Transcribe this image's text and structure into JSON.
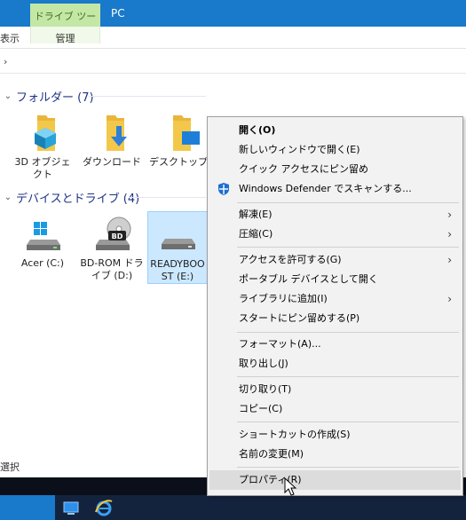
{
  "ribbon": {
    "context_tab": "ドライブ ツール",
    "window_title": "PC",
    "view_tab": "表示",
    "manage_tab": "管理"
  },
  "address": {
    "chevron": "›"
  },
  "folders_group": {
    "label": "フォルダー (7)",
    "items": [
      {
        "name": "3D オブジェクト",
        "icon": "folder-3d-icon"
      },
      {
        "name": "ダウンロード",
        "icon": "folder-download-icon"
      },
      {
        "name": "デスクトップ",
        "icon": "folder-desktop-icon"
      }
    ]
  },
  "drives_group": {
    "label": "デバイスとドライブ (4)",
    "items": [
      {
        "name": "Acer (C:)",
        "icon": "windows-drive-icon"
      },
      {
        "name": "BD-ROM ドライブ (D:)",
        "icon": "bd-drive-icon"
      },
      {
        "name": "READYBOOST (E:)",
        "icon": "usb-drive-icon"
      }
    ]
  },
  "status": {
    "text": "選択"
  },
  "context_menu": {
    "items": [
      {
        "label": "開く(O)",
        "bold": true
      },
      {
        "label": "新しいウィンドウで開く(E)"
      },
      {
        "label": "クイック アクセスにピン留め"
      },
      {
        "label": "Windows Defender でスキャンする...",
        "icon": "windows-defender-icon"
      },
      {
        "label": "解凍(E)",
        "submenu": true
      },
      {
        "label": "圧縮(C)",
        "submenu": true
      },
      {
        "label": "アクセスを許可する(G)",
        "submenu": true
      },
      {
        "label": "ポータブル デバイスとして開く"
      },
      {
        "label": "ライブラリに追加(I)",
        "submenu": true
      },
      {
        "label": "スタートにピン留めする(P)"
      },
      {
        "label": "フォーマット(A)..."
      },
      {
        "label": "取り出し(J)"
      },
      {
        "label": "切り取り(T)"
      },
      {
        "label": "コピー(C)"
      },
      {
        "label": "ショートカットの作成(S)"
      },
      {
        "label": "名前の変更(M)"
      },
      {
        "label": "プロパティ(R)",
        "hover": true
      }
    ]
  },
  "colors": {
    "ribbon_blue": "#1979ca",
    "context_green": "#c4e7a6",
    "group_header": "#1e3287",
    "folder_yellow": "#f3c84a",
    "selection": "#cce8ff"
  }
}
